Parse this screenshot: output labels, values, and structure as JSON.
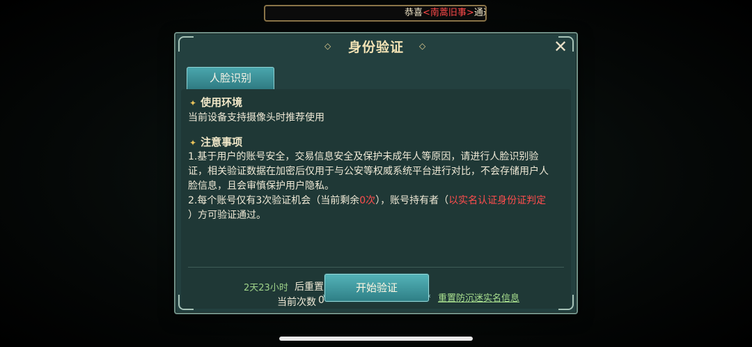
{
  "marquee": {
    "prefix": "恭喜",
    "highlight": "<南蒿旧事>",
    "suffix": "通过"
  },
  "dialog": {
    "title": "身份验证",
    "tab_label": "人脸识别",
    "section1": {
      "title": "使用环境",
      "text": "当前设备支持摄像头时推荐使用"
    },
    "section2": {
      "title": "注意事项",
      "line1a": "1.基于用户的账号安全，交易信息安全及保护未成年人等原因，请进行人脸识别验",
      "line1b": "证，相关验证数据在加密后仅用于与公安等权威系统平台进行对比，不会存储用户人",
      "line1c": "脸信息，且会审慎保护用户隐私。",
      "line2_pre": "2.每个账号仅有3次验证机会（当前剩余",
      "line2_red": "0次",
      "line2_mid": "），账号持有者（",
      "line2_red2": "以实名认证身份证判定",
      "line3": "）方可验证通过。"
    },
    "timer_value": "2天23小时",
    "timer_suffix": "后重置",
    "count_label": "当前次数",
    "count_value": "0",
    "start_button": "开始验证",
    "reset_link": "重置防沉迷实名信息"
  },
  "colors": {
    "accent": "#3f9aa0",
    "panel": "#23403f",
    "warning": "#ff4d4d",
    "timer": "#9fd38a"
  },
  "icons": {
    "close": "close-icon",
    "bullet": "star-bullet-icon"
  }
}
